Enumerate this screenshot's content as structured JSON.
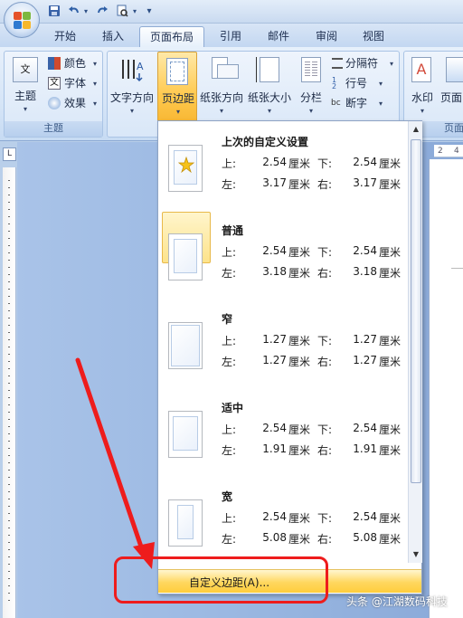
{
  "quick_access": {
    "undo_icon": "undo-icon",
    "redo_icon": "redo-icon",
    "save_icon": "save-icon",
    "customize_icon": "customize-icon"
  },
  "tabs": [
    {
      "label": "开始"
    },
    {
      "label": "插入"
    },
    {
      "label": "页面布局",
      "active": true
    },
    {
      "label": "引用"
    },
    {
      "label": "邮件"
    },
    {
      "label": "审阅"
    },
    {
      "label": "视图"
    }
  ],
  "ribbon": {
    "theme_group": {
      "label": "主题",
      "theme_button": "主题",
      "colors": "颜色",
      "fonts": "字体",
      "effects": "效果"
    },
    "page_setup_group": {
      "text_direction": "文字方向",
      "margins": "页边距",
      "orientation": "纸张方向",
      "size": "纸张大小",
      "columns": "分栏",
      "breaks": "分隔符",
      "line_numbers": "行号",
      "hyphenation": "断字"
    },
    "page_background_group": {
      "label": "页面",
      "watermark": "水印",
      "page_color": "页面"
    }
  },
  "ruler": {
    "corner_symbol": "L",
    "h_tick_a": "2",
    "h_tick_b": "4"
  },
  "margins_menu": {
    "presets": [
      {
        "title": "上次的自定义设置",
        "top_label": "上:",
        "top": "2.54",
        "bottom_label": "下:",
        "bottom": "2.54",
        "left_label": "左:",
        "left": "3.17",
        "right_label": "右:",
        "right": "3.17",
        "unit": "厘米",
        "selected": false,
        "icon": "star-icon"
      },
      {
        "title": "普通",
        "top_label": "上:",
        "top": "2.54",
        "bottom_label": "下:",
        "bottom": "2.54",
        "left_label": "左:",
        "left": "3.18",
        "right_label": "右:",
        "right": "3.18",
        "unit": "厘米",
        "selected": true
      },
      {
        "title": "窄",
        "top_label": "上:",
        "top": "1.27",
        "bottom_label": "下:",
        "bottom": "1.27",
        "left_label": "左:",
        "left": "1.27",
        "right_label": "右:",
        "right": "1.27",
        "unit": "厘米",
        "selected": false
      },
      {
        "title": "适中",
        "top_label": "上:",
        "top": "2.54",
        "bottom_label": "下:",
        "bottom": "2.54",
        "left_label": "左:",
        "left": "1.91",
        "right_label": "右:",
        "right": "1.91",
        "unit": "厘米",
        "selected": false
      },
      {
        "title": "宽",
        "top_label": "上:",
        "top": "2.54",
        "bottom_label": "下:",
        "bottom": "2.54",
        "left_label": "左:",
        "left": "5.08",
        "right_label": "右:",
        "right": "5.08",
        "unit": "厘米",
        "selected": false
      }
    ],
    "custom_margins": "自定义边距(A)...",
    "custom_margins_accesskey": "A"
  },
  "annotation": {
    "arrow_color": "#ee1c1c",
    "box_color": "#ee1c1c"
  },
  "watermark": {
    "text": "头条 @江湖数码科技"
  },
  "colors": {
    "selected_fill": "#fde38b",
    "menu_hover": "#ffd75e",
    "ribbon_bg": "#d6e5f7"
  }
}
